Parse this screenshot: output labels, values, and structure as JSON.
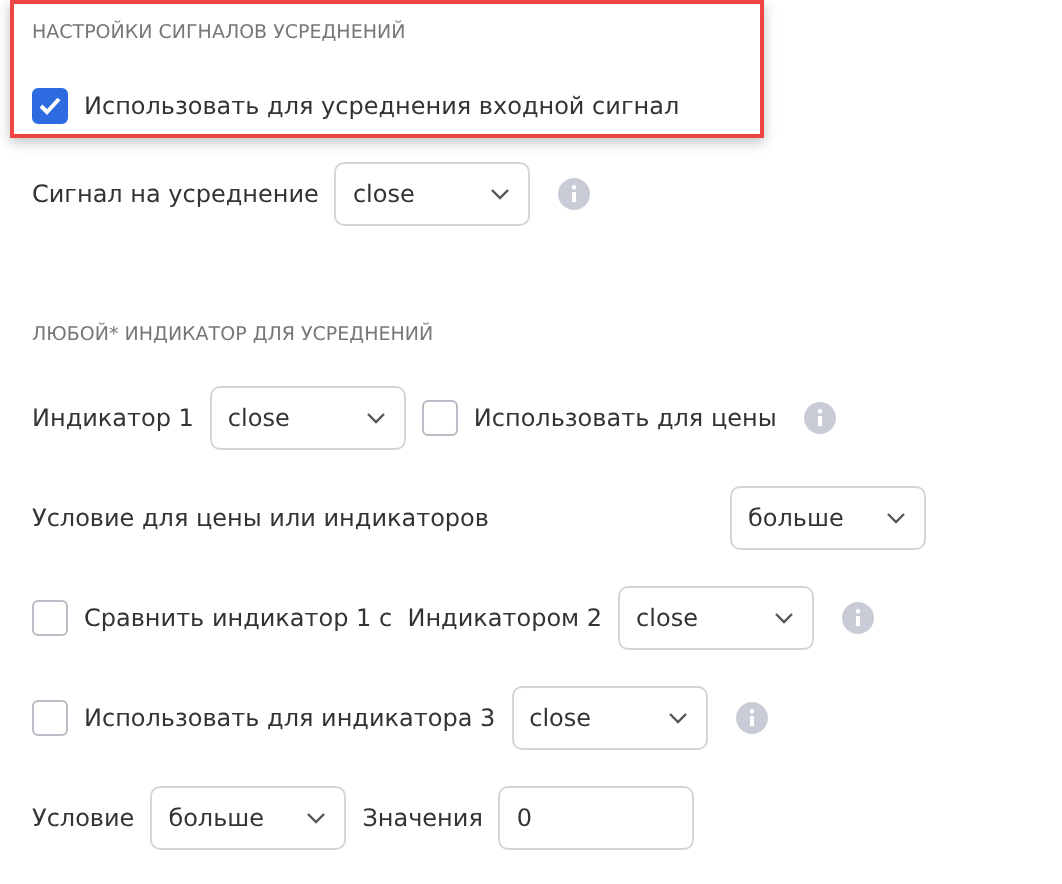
{
  "sections": [
    {
      "heading": "НАСТРОЙКИ СИГНАЛОВ УСРЕДНЕНИЙ",
      "highlighted": true,
      "rows": [
        {
          "kind": "flow",
          "items": [
            {
              "kind": "checkbox",
              "checked": true,
              "label": "Использовать для усреднения входной сигнал"
            }
          ]
        }
      ]
    },
    {
      "highlighted": false,
      "rows": [
        {
          "kind": "flow",
          "items": [
            {
              "kind": "label",
              "text": "Сигнал на усреднение"
            },
            {
              "kind": "select",
              "value": "close"
            },
            {
              "kind": "info"
            }
          ]
        }
      ]
    },
    {
      "heading": "ЛЮБОЙ* ИНДИКАТОР ДЛЯ УСРЕДНЕНИЙ",
      "highlighted": false,
      "rows": [
        {
          "kind": "flow",
          "items": [
            {
              "kind": "label",
              "text": "Индикатор 1"
            },
            {
              "kind": "select",
              "value": "close"
            },
            {
              "kind": "checkbox",
              "checked": false,
              "label": "Использовать для цены"
            },
            {
              "kind": "info"
            }
          ]
        },
        {
          "kind": "split",
          "items": [
            {
              "kind": "label",
              "text": "Условие для цены или индикаторов"
            },
            {
              "kind": "select",
              "value": "больше"
            }
          ]
        },
        {
          "kind": "flow",
          "items": [
            {
              "kind": "checkbox",
              "checked": false,
              "label": "Сравнить индикатор 1 с  Индикатором 2"
            },
            {
              "kind": "select",
              "value": "close"
            },
            {
              "kind": "info"
            }
          ]
        },
        {
          "kind": "flow",
          "items": [
            {
              "kind": "checkbox",
              "checked": false,
              "label": "Использовать для индикатора 3"
            },
            {
              "kind": "select",
              "value": "close"
            },
            {
              "kind": "info"
            }
          ]
        },
        {
          "kind": "flow",
          "items": [
            {
              "kind": "label",
              "text": "Условие"
            },
            {
              "kind": "select",
              "value": "больше"
            },
            {
              "kind": "label",
              "text": "Значения"
            },
            {
              "kind": "input",
              "value": "0"
            }
          ]
        }
      ]
    }
  ]
}
